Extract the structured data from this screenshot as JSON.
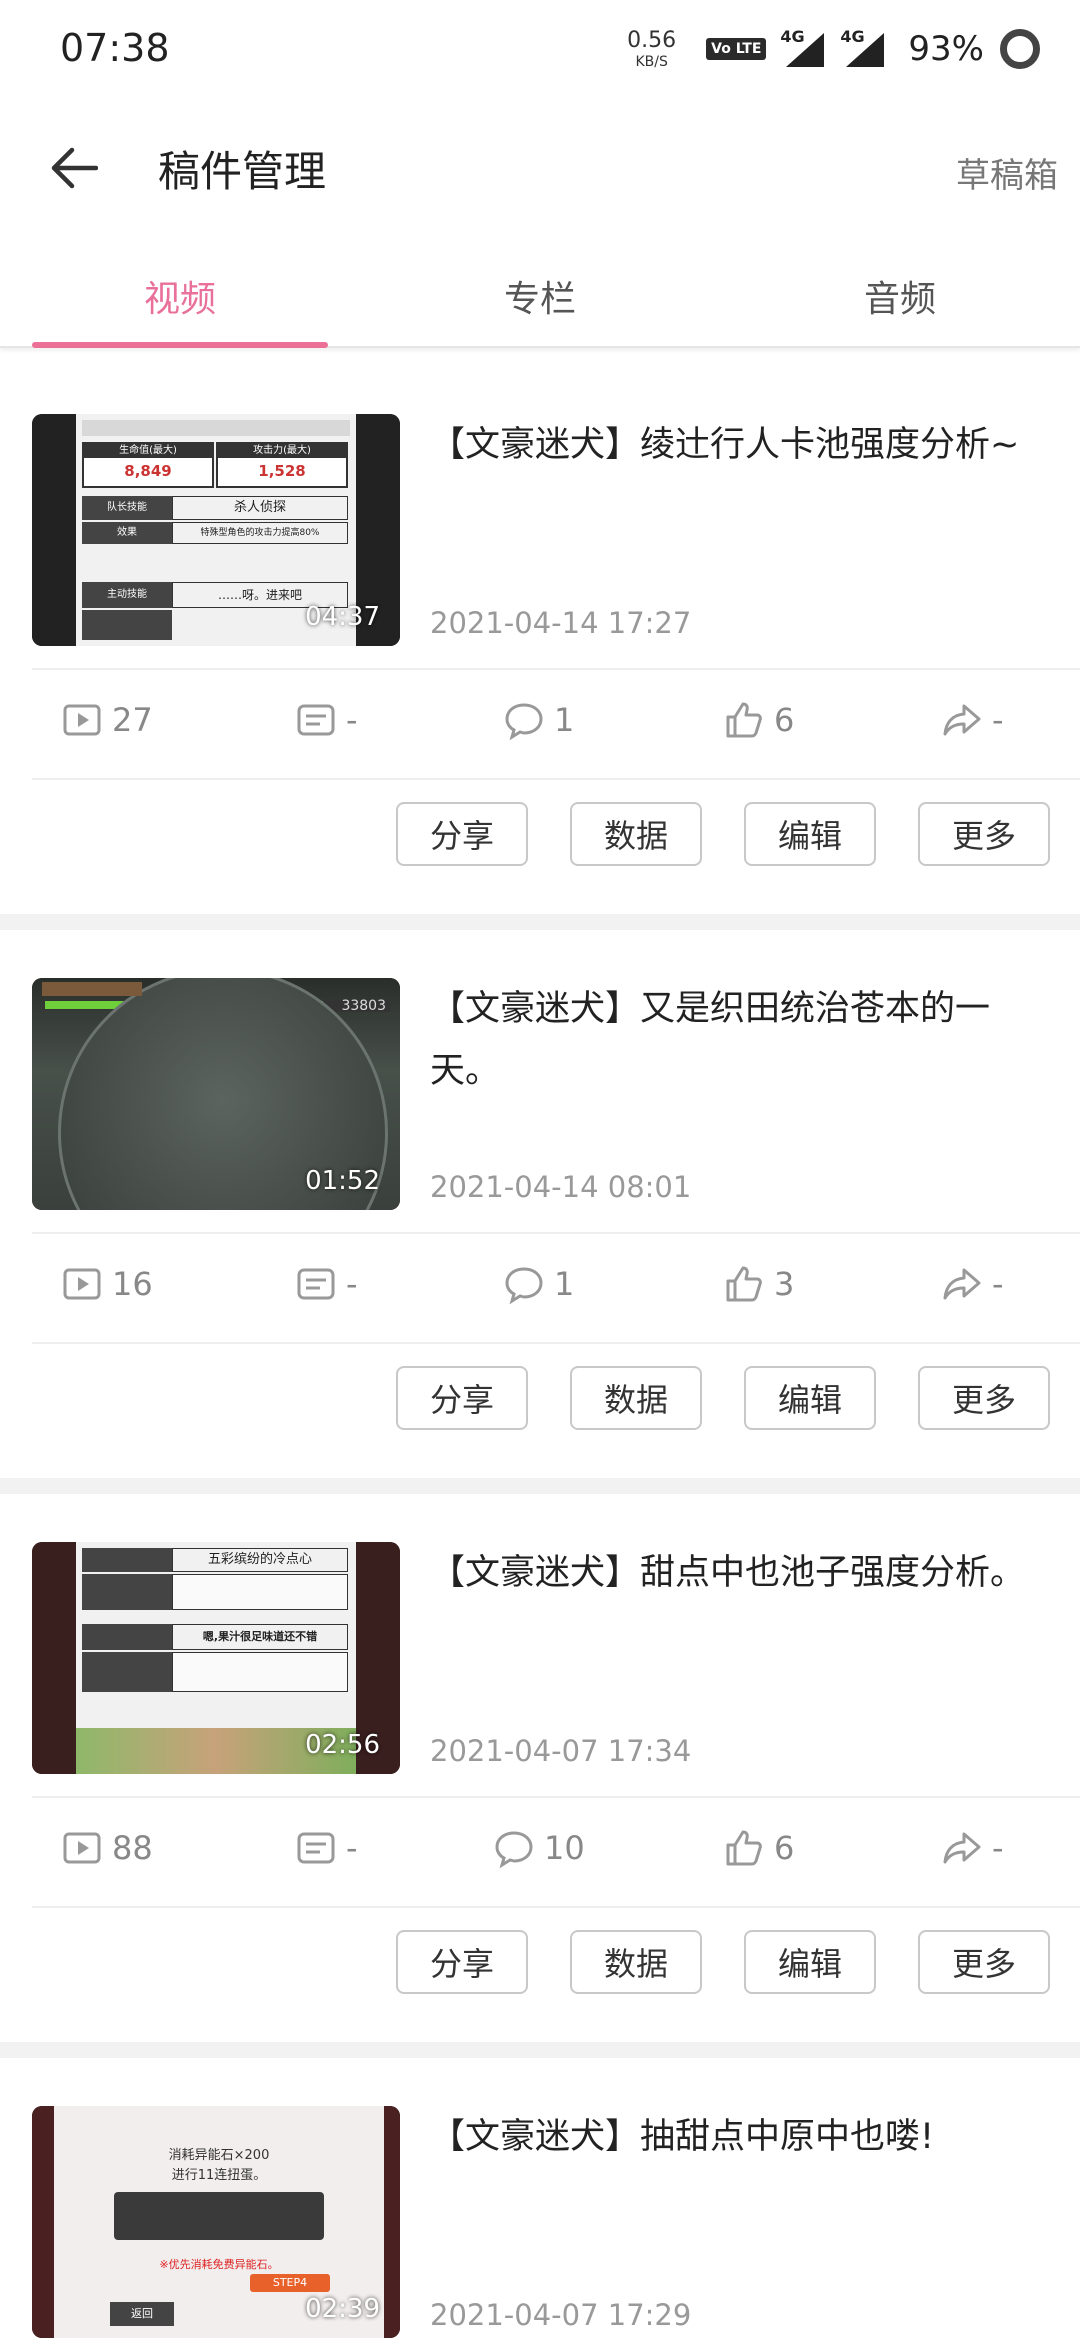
{
  "status_bar": {
    "time": "07:38",
    "net_speed": "0.56",
    "net_unit": "KB/S",
    "volte_label": "Vo LTE",
    "signal1_tag": "4G",
    "signal2_tag": "4G",
    "battery": "93%"
  },
  "header": {
    "title": "稿件管理",
    "drafts": "草稿箱",
    "back_icon": "arrow-left-icon"
  },
  "tabs": [
    {
      "label": "视频",
      "active": true
    },
    {
      "label": "专栏",
      "active": false
    },
    {
      "label": "音频",
      "active": false
    }
  ],
  "videos": [
    {
      "title": "【文豪迷犬】绫辻行人卡池强度分析~",
      "date": "2021-04-14 17:27",
      "duration": "04:37",
      "plays": "27",
      "danmaku": "-",
      "comments": "1",
      "likes": "6",
      "shares": "-"
    },
    {
      "title": "【文豪迷犬】又是织田统治苍本的一天。",
      "date": "2021-04-14 08:01",
      "duration": "01:52",
      "plays": "16",
      "danmaku": "-",
      "comments": "1",
      "likes": "3",
      "shares": "-"
    },
    {
      "title": "【文豪迷犬】甜点中也池子强度分析。",
      "date": "2021-04-07 17:34",
      "duration": "02:56",
      "plays": "88",
      "danmaku": "-",
      "comments": "10",
      "likes": "6",
      "shares": "-"
    },
    {
      "title": "【文豪迷犬】抽甜点中原中也喽!",
      "date": "2021-04-07 17:29",
      "duration": "02:39"
    }
  ],
  "actions": {
    "share": "分享",
    "data": "数据",
    "edit": "编辑",
    "more": "更多"
  },
  "thumb_text": {
    "v1_hp": "生命值(最大)",
    "v1_atk": "攻击力(最大)",
    "v1_hp_val": "8,849",
    "v1_atk_val": "1,528",
    "v1_skill_label": "队长技能",
    "v1_skill": "杀人侦探",
    "v1_effect_label": "效果",
    "v1_effect": "特殊型角色的攻击力提高80%",
    "v1_active_label": "主动技能",
    "v1_active": "……呀。进来吧",
    "v2_score": "33803",
    "v3_skill": "五彩缤纷的冷点心",
    "v3_active": "嗯,果汁很足味道还不错",
    "v4_line1": "消耗异能石×200",
    "v4_line2": "进行11连扭蛋。",
    "v4_note": "※优先消耗免费异能石。",
    "v4_back": "返回",
    "v4_step": "STEP4"
  },
  "colors": {
    "accent": "#ec6f98",
    "separator": "#f2f2f2"
  }
}
